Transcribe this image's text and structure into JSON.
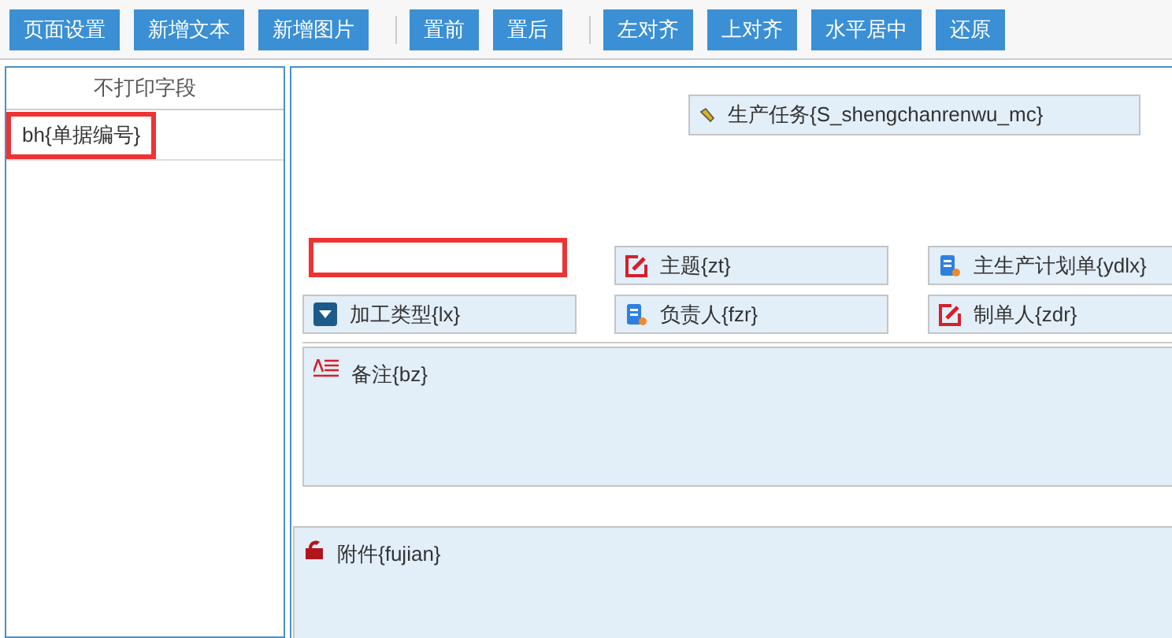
{
  "toolbar": {
    "groups": [
      [
        "页面设置",
        "新增文本",
        "新增图片"
      ],
      [
        "置前",
        "置后"
      ],
      [
        "左对齐",
        "上对齐",
        "水平居中",
        "还原"
      ]
    ]
  },
  "left_panel": {
    "title": "不打印字段",
    "items": [
      {
        "label": "bh{单据编号}",
        "highlighted": true
      }
    ]
  },
  "canvas": {
    "fields": [
      {
        "kind": "tag",
        "label": "生产任务{S_shengchanrenwu_mc}",
        "highlighted": false
      },
      {
        "kind": "blank",
        "highlighted": true
      },
      {
        "kind": "edit",
        "label": "主题{zt}",
        "highlighted": false
      },
      {
        "kind": "doc",
        "label": "主生产计划单{ydlx}",
        "highlighted": false
      },
      {
        "kind": "select",
        "label": "加工类型{lx}",
        "highlighted": false
      },
      {
        "kind": "doc",
        "label": "负责人{fzr}",
        "highlighted": false
      },
      {
        "kind": "edit",
        "label": "制单人{zdr}",
        "highlighted": false
      },
      {
        "kind": "text",
        "label": "备注{bz}",
        "highlighted": false
      },
      {
        "kind": "attach",
        "label": "附件{fujian}",
        "highlighted": false
      }
    ]
  }
}
